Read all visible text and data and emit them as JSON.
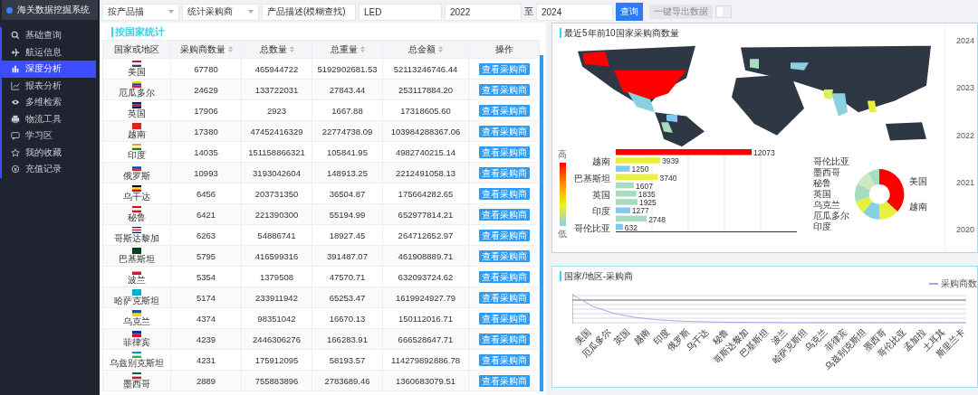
{
  "sidebar": {
    "title": "海关数据挖掘系统",
    "items": [
      {
        "label": "基础查询",
        "selected": false
      },
      {
        "label": "航运信息",
        "selected": false
      },
      {
        "label": "深度分析",
        "selected": true
      },
      {
        "label": "报表分析",
        "selected": false
      },
      {
        "label": "多维检索",
        "selected": false
      },
      {
        "label": "物流工具",
        "selected": false
      },
      {
        "label": "学习区",
        "selected": false
      },
      {
        "label": "我的收藏",
        "selected": false
      },
      {
        "label": "充值记录",
        "selected": false
      }
    ]
  },
  "filters": {
    "search_mode": "按产品描",
    "stat_mode": "统计采购商",
    "field_mode": "产品描述(模糊查找)",
    "keyword": "LED",
    "year_from": "2022",
    "separator": "至",
    "year_to": "2024",
    "query_button": "查询",
    "export_button": {
      "label": "一键导出数据",
      "disabled": true
    },
    "toggle": {
      "on": false
    }
  },
  "table": {
    "title": "按国家统计",
    "columns": [
      {
        "label": "国家或地区",
        "sortable": false
      },
      {
        "label": "采购商数量",
        "sortable": true
      },
      {
        "label": "总数量",
        "sortable": true
      },
      {
        "label": "总重量",
        "sortable": true
      },
      {
        "label": "总金额",
        "sortable": true
      },
      {
        "label": "操作",
        "sortable": false
      }
    ],
    "rows": [
      {
        "country": "美国",
        "kind": "us",
        "buyers": "67780",
        "quantity": "465944722",
        "weight": "5192902681.53",
        "amount": "52113246746.44",
        "action": "查看采购商"
      },
      {
        "country": "厄瓜多尔",
        "kind": "ec",
        "buyers": "24629",
        "quantity": "133722031",
        "weight": "27843.44",
        "amount": "253117884.20",
        "action": "查看采购商"
      },
      {
        "country": "英国",
        "kind": "gb",
        "buyers": "17906",
        "quantity": "2923",
        "weight": "1667.88",
        "amount": "17318605.60",
        "action": "查看采购商"
      },
      {
        "country": "越南",
        "kind": "vn",
        "buyers": "17380",
        "quantity": "47452416329",
        "weight": "22774738.09",
        "amount": "103984288367.06",
        "action": "查看采购商"
      },
      {
        "country": "印度",
        "kind": "in",
        "buyers": "14035",
        "quantity": "151158866321",
        "weight": "105841.95",
        "amount": "4982740215.14",
        "action": "查看采购商"
      },
      {
        "country": "俄罗斯",
        "kind": "ru",
        "buyers": "10993",
        "quantity": "3193042604",
        "weight": "148913.25",
        "amount": "2212491058.13",
        "action": "查看采购商"
      },
      {
        "country": "乌干达",
        "kind": "ug",
        "buyers": "6456",
        "quantity": "203731350",
        "weight": "36504.87",
        "amount": "175664282.65",
        "action": "查看采购商"
      },
      {
        "country": "秘鲁",
        "kind": "pe",
        "buyers": "6421",
        "quantity": "221390300",
        "weight": "55194.99",
        "amount": "652977814.21",
        "action": "查看采购商"
      },
      {
        "country": "哥斯达黎加",
        "kind": "cr",
        "buyers": "6263",
        "quantity": "54886741",
        "weight": "18927.45",
        "amount": "264712652.97",
        "action": "查看采购商"
      },
      {
        "country": "巴基斯坦",
        "kind": "pk",
        "buyers": "5795",
        "quantity": "416599316",
        "weight": "391487.07",
        "amount": "461908889.71",
        "action": "查看采购商"
      },
      {
        "country": "波兰",
        "kind": "pl",
        "buyers": "5354",
        "quantity": "1379508",
        "weight": "47570.71",
        "amount": "632093724.62",
        "action": "查看采购商"
      },
      {
        "country": "哈萨克斯坦",
        "kind": "kz",
        "buyers": "5174",
        "quantity": "233911942",
        "weight": "65253.47",
        "amount": "1619924927.79",
        "action": "查看采购商"
      },
      {
        "country": "乌克兰",
        "kind": "ua",
        "buyers": "4374",
        "quantity": "98351042",
        "weight": "16670.13",
        "amount": "150112016.71",
        "action": "查看采购商"
      },
      {
        "country": "菲律宾",
        "kind": "ph",
        "buyers": "4239",
        "quantity": "2446306276",
        "weight": "166283.91",
        "amount": "666528647.71",
        "action": "查看采购商"
      },
      {
        "country": "乌兹别克斯坦",
        "kind": "uz",
        "buyers": "4231",
        "quantity": "175912095",
        "weight": "58193.57",
        "amount": "114279892886.78",
        "action": "查看采购商"
      },
      {
        "country": "墨西哥",
        "kind": "mx",
        "buyers": "2889",
        "quantity": "755883896",
        "weight": "2783689.46",
        "amount": "1360683079.51",
        "action": "查看采购商"
      }
    ]
  },
  "map_card": {
    "title": "最近5年前10国家采购商数量",
    "legend_high": "高",
    "legend_low": "低",
    "bar_axis_labels": [
      "越南",
      "巴基斯坦",
      "英国",
      "印度",
      "哥伦比亚"
    ],
    "bar_values": [
      "12073",
      "3939",
      "1250",
      "3740",
      "1607",
      "1835",
      "1925",
      "1277",
      "2748",
      "632"
    ],
    "donut_labels_left": [
      "哥伦比亚",
      "墨西哥",
      "秘鲁",
      "英国",
      "乌克兰",
      "厄瓜多尔",
      "印度"
    ],
    "donut_labels_right": [
      "美国",
      "越南"
    ],
    "timeline": [
      "2024",
      "2023",
      "2022",
      "2021",
      "2020"
    ]
  },
  "line_card": {
    "title": "国家/地区-采购商",
    "legend": "采购商数",
    "x_labels": [
      "美国",
      "厄瓜多尔",
      "英国",
      "越南",
      "印度",
      "俄罗斯",
      "乌干达",
      "秘鲁",
      "哥斯达黎加",
      "巴基斯坦",
      "波兰",
      "哈萨克斯坦",
      "乌克兰",
      "菲律宾",
      "乌兹别克斯坦",
      "墨西哥",
      "哥伦比亚",
      "孟加拉",
      "土耳其",
      "斯里兰卡"
    ]
  }
}
